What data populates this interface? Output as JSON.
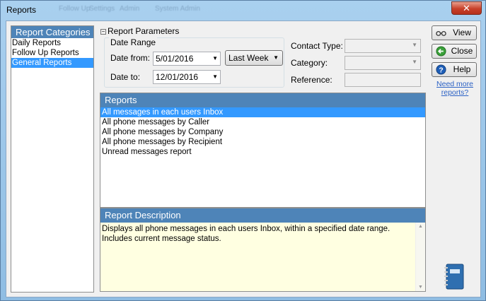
{
  "window": {
    "title": "Reports",
    "close_glyph": "✕"
  },
  "ghost_tabs": [
    "Follow Up",
    "Settings",
    "Admin",
    "System Admin"
  ],
  "categories": {
    "header": "Report Categories",
    "items": [
      {
        "label": "Daily Reports",
        "selected": false
      },
      {
        "label": "Follow Up Reports",
        "selected": false
      },
      {
        "label": "General Reports",
        "selected": true
      }
    ]
  },
  "params": {
    "section_label": "Report Parameters",
    "expander_glyph": "⊟",
    "date_range": {
      "legend": "Date Range",
      "from_label": "Date from:",
      "from_value": "5/01/2016",
      "to_label": "Date to:",
      "to_value": "12/01/2016",
      "preset_value": "Last Week",
      "dropdown_glyph": "▼"
    },
    "contact_type_label": "Contact Type:",
    "contact_type_value": "",
    "category_label": "Category:",
    "category_value": "",
    "reference_label": "Reference:",
    "reference_value": ""
  },
  "reports": {
    "header": "Reports",
    "items": [
      {
        "label": "All messages in each users Inbox",
        "selected": true
      },
      {
        "label": "All phone messages by Caller",
        "selected": false
      },
      {
        "label": "All phone messages by Company",
        "selected": false
      },
      {
        "label": "All phone messages by Recipient",
        "selected": false
      },
      {
        "label": "Unread messages report",
        "selected": false
      }
    ]
  },
  "description": {
    "header": "Report Description",
    "text": "Displays all phone messages in each users Inbox, within a specified date range.  Includes current message status."
  },
  "buttons": {
    "view": "View",
    "close": "Close",
    "help": "Help"
  },
  "links": {
    "need_more": "Need more reports?"
  },
  "colors": {
    "header_blue": "#4e84b8",
    "selection_blue": "#3399ff",
    "desc_bg": "#ffffe1",
    "close_red": "#c8402a"
  }
}
